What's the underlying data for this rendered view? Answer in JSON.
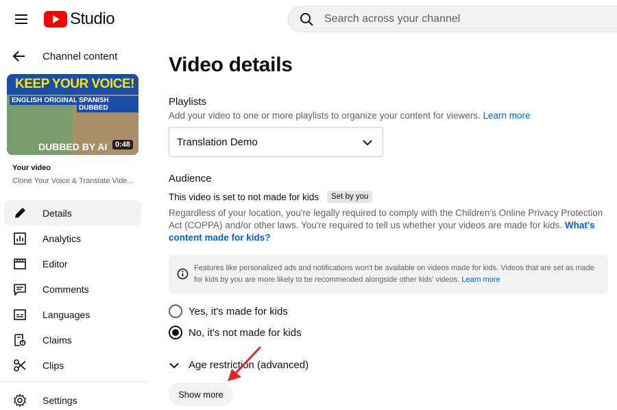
{
  "header": {
    "logo_text": "Studio",
    "search_placeholder": "Search across your channel"
  },
  "sidebar": {
    "back_label": "Channel content",
    "thumbnail": {
      "top_text": "KEEP YOUR VOICE!",
      "left_label": "ENGLISH  ORIGINAL",
      "right_label": "SPANISH  DUBBED",
      "bottom_text": "DUBBED BY AI",
      "duration": "0:48"
    },
    "your_video_label": "Your video",
    "video_title": "Clone Your Voice & Translate Vide...",
    "items": [
      {
        "label": "Details",
        "icon": "pencil-icon",
        "active": true
      },
      {
        "label": "Analytics",
        "icon": "analytics-icon"
      },
      {
        "label": "Editor",
        "icon": "editor-icon"
      },
      {
        "label": "Comments",
        "icon": "comments-icon"
      },
      {
        "label": "Languages",
        "icon": "languages-icon"
      },
      {
        "label": "Claims",
        "icon": "claims-icon"
      },
      {
        "label": "Clips",
        "icon": "scissors-icon"
      }
    ],
    "settings_label": "Settings"
  },
  "main": {
    "page_title": "Video details",
    "playlists": {
      "heading": "Playlists",
      "description": "Add your video to one or more playlists to organize your content for viewers.",
      "learn_more": "Learn more",
      "selected": "Translation Demo"
    },
    "audience": {
      "heading": "Audience",
      "status": "This video is set to not made for kids",
      "badge": "Set by you",
      "description": "Regardless of your location, you're legally required to comply with the Children's Online Privacy Protection Act (COPPA) and/or other laws. You're required to tell us whether your videos are made for kids.",
      "link": "What's content made for kids?",
      "info": "Features like personalized ads and notifications won't be available on videos made for kids. Videos that are set as made for kids by you are more likely to be recommended alongside other kids' videos.",
      "info_link": "Learn more",
      "option_yes": "Yes, it's made for kids",
      "option_no": "No, it's not made for kids",
      "selected": "no"
    },
    "age_restriction_label": "Age restriction (advanced)",
    "show_more_label": "Show more"
  },
  "colors": {
    "accent_red": "#ff0000",
    "link_blue": "#065fd4",
    "annotation_arrow": "#e3262b"
  }
}
